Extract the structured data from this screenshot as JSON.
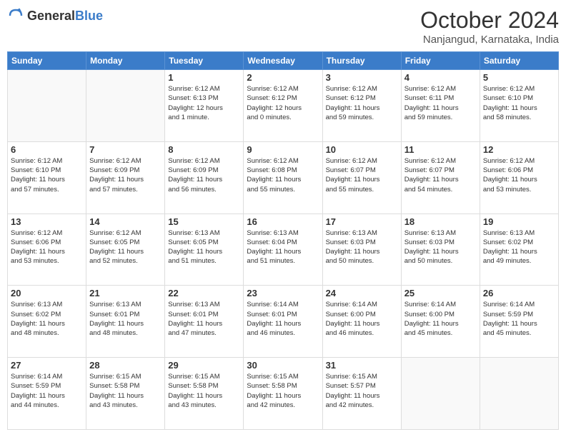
{
  "logo": {
    "general": "General",
    "blue": "Blue"
  },
  "header": {
    "month": "October 2024",
    "location": "Nanjangud, Karnataka, India"
  },
  "weekdays": [
    "Sunday",
    "Monday",
    "Tuesday",
    "Wednesday",
    "Thursday",
    "Friday",
    "Saturday"
  ],
  "weeks": [
    [
      {
        "day": "",
        "info": ""
      },
      {
        "day": "",
        "info": ""
      },
      {
        "day": "1",
        "info": "Sunrise: 6:12 AM\nSunset: 6:13 PM\nDaylight: 12 hours\nand 1 minute."
      },
      {
        "day": "2",
        "info": "Sunrise: 6:12 AM\nSunset: 6:12 PM\nDaylight: 12 hours\nand 0 minutes."
      },
      {
        "day": "3",
        "info": "Sunrise: 6:12 AM\nSunset: 6:12 PM\nDaylight: 11 hours\nand 59 minutes."
      },
      {
        "day": "4",
        "info": "Sunrise: 6:12 AM\nSunset: 6:11 PM\nDaylight: 11 hours\nand 59 minutes."
      },
      {
        "day": "5",
        "info": "Sunrise: 6:12 AM\nSunset: 6:10 PM\nDaylight: 11 hours\nand 58 minutes."
      }
    ],
    [
      {
        "day": "6",
        "info": "Sunrise: 6:12 AM\nSunset: 6:10 PM\nDaylight: 11 hours\nand 57 minutes."
      },
      {
        "day": "7",
        "info": "Sunrise: 6:12 AM\nSunset: 6:09 PM\nDaylight: 11 hours\nand 57 minutes."
      },
      {
        "day": "8",
        "info": "Sunrise: 6:12 AM\nSunset: 6:09 PM\nDaylight: 11 hours\nand 56 minutes."
      },
      {
        "day": "9",
        "info": "Sunrise: 6:12 AM\nSunset: 6:08 PM\nDaylight: 11 hours\nand 55 minutes."
      },
      {
        "day": "10",
        "info": "Sunrise: 6:12 AM\nSunset: 6:07 PM\nDaylight: 11 hours\nand 55 minutes."
      },
      {
        "day": "11",
        "info": "Sunrise: 6:12 AM\nSunset: 6:07 PM\nDaylight: 11 hours\nand 54 minutes."
      },
      {
        "day": "12",
        "info": "Sunrise: 6:12 AM\nSunset: 6:06 PM\nDaylight: 11 hours\nand 53 minutes."
      }
    ],
    [
      {
        "day": "13",
        "info": "Sunrise: 6:12 AM\nSunset: 6:06 PM\nDaylight: 11 hours\nand 53 minutes."
      },
      {
        "day": "14",
        "info": "Sunrise: 6:12 AM\nSunset: 6:05 PM\nDaylight: 11 hours\nand 52 minutes."
      },
      {
        "day": "15",
        "info": "Sunrise: 6:13 AM\nSunset: 6:05 PM\nDaylight: 11 hours\nand 51 minutes."
      },
      {
        "day": "16",
        "info": "Sunrise: 6:13 AM\nSunset: 6:04 PM\nDaylight: 11 hours\nand 51 minutes."
      },
      {
        "day": "17",
        "info": "Sunrise: 6:13 AM\nSunset: 6:03 PM\nDaylight: 11 hours\nand 50 minutes."
      },
      {
        "day": "18",
        "info": "Sunrise: 6:13 AM\nSunset: 6:03 PM\nDaylight: 11 hours\nand 50 minutes."
      },
      {
        "day": "19",
        "info": "Sunrise: 6:13 AM\nSunset: 6:02 PM\nDaylight: 11 hours\nand 49 minutes."
      }
    ],
    [
      {
        "day": "20",
        "info": "Sunrise: 6:13 AM\nSunset: 6:02 PM\nDaylight: 11 hours\nand 48 minutes."
      },
      {
        "day": "21",
        "info": "Sunrise: 6:13 AM\nSunset: 6:01 PM\nDaylight: 11 hours\nand 48 minutes."
      },
      {
        "day": "22",
        "info": "Sunrise: 6:13 AM\nSunset: 6:01 PM\nDaylight: 11 hours\nand 47 minutes."
      },
      {
        "day": "23",
        "info": "Sunrise: 6:14 AM\nSunset: 6:01 PM\nDaylight: 11 hours\nand 46 minutes."
      },
      {
        "day": "24",
        "info": "Sunrise: 6:14 AM\nSunset: 6:00 PM\nDaylight: 11 hours\nand 46 minutes."
      },
      {
        "day": "25",
        "info": "Sunrise: 6:14 AM\nSunset: 6:00 PM\nDaylight: 11 hours\nand 45 minutes."
      },
      {
        "day": "26",
        "info": "Sunrise: 6:14 AM\nSunset: 5:59 PM\nDaylight: 11 hours\nand 45 minutes."
      }
    ],
    [
      {
        "day": "27",
        "info": "Sunrise: 6:14 AM\nSunset: 5:59 PM\nDaylight: 11 hours\nand 44 minutes."
      },
      {
        "day": "28",
        "info": "Sunrise: 6:15 AM\nSunset: 5:58 PM\nDaylight: 11 hours\nand 43 minutes."
      },
      {
        "day": "29",
        "info": "Sunrise: 6:15 AM\nSunset: 5:58 PM\nDaylight: 11 hours\nand 43 minutes."
      },
      {
        "day": "30",
        "info": "Sunrise: 6:15 AM\nSunset: 5:58 PM\nDaylight: 11 hours\nand 42 minutes."
      },
      {
        "day": "31",
        "info": "Sunrise: 6:15 AM\nSunset: 5:57 PM\nDaylight: 11 hours\nand 42 minutes."
      },
      {
        "day": "",
        "info": ""
      },
      {
        "day": "",
        "info": ""
      }
    ]
  ]
}
